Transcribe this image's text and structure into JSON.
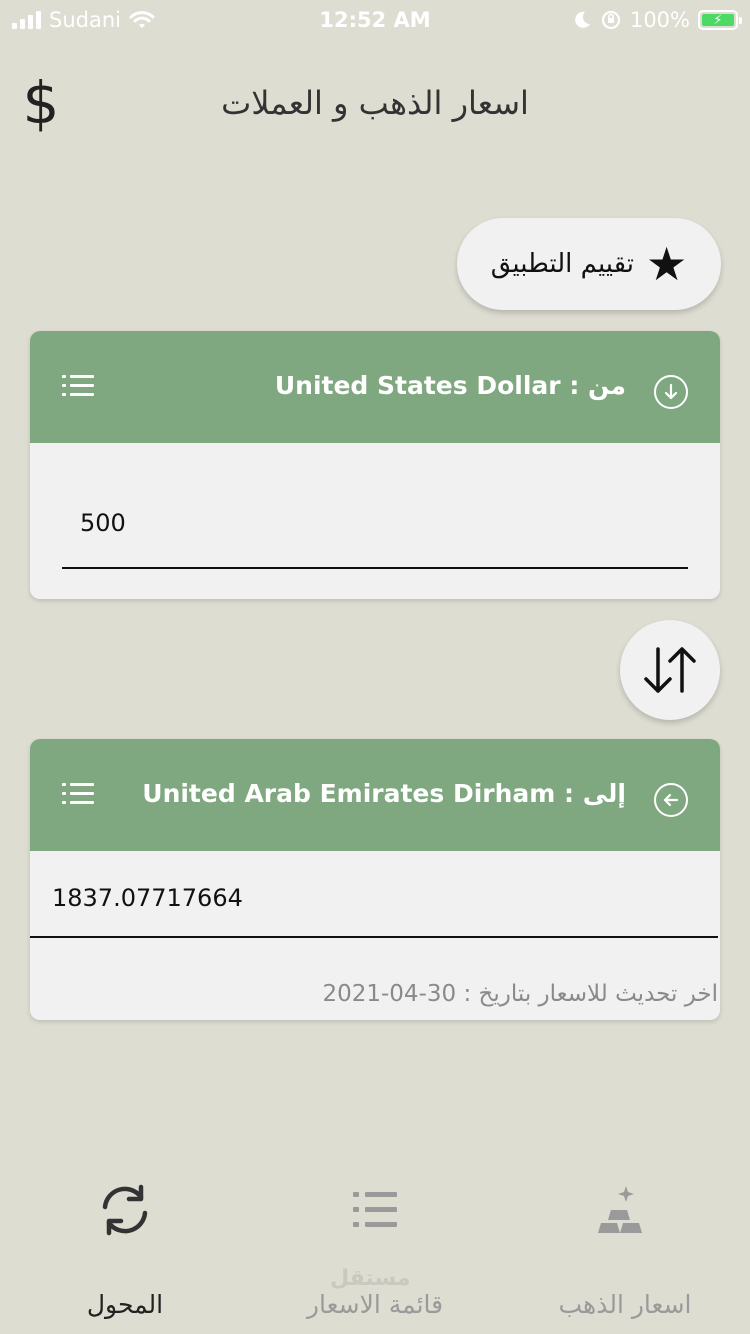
{
  "status_bar": {
    "carrier": "Sudani",
    "time": "12:52 AM",
    "battery": "100%"
  },
  "header": {
    "title": "اسعار الذهب و العملات",
    "dollar_icon": "dollar-icon"
  },
  "rate_button": {
    "label": "تقييم التطبيق",
    "icon": "star-icon"
  },
  "from_card": {
    "label": "من : United States Dollar",
    "amount": "500",
    "icon": "arrow-down-circle-icon",
    "menu_icon": "list-icon"
  },
  "to_card": {
    "label": "إلى : United Arab Emirates Dirham",
    "result": "1837.07717664",
    "update_note": "اخر تحديث للاسعار بتاريخ : 30-04-2021",
    "icon": "arrow-left-circle-icon",
    "menu_icon": "list-icon"
  },
  "bottom_nav": {
    "items": [
      {
        "label": "المحول",
        "icon": "refresh-icon",
        "active": true
      },
      {
        "label": "قائمة الاسعار",
        "icon": "list-icon",
        "active": false
      },
      {
        "label": "اسعار الذهب",
        "icon": "gold-bars-icon",
        "active": false
      }
    ]
  },
  "watermark": "مستقل",
  "colors": {
    "background": "#deddd2",
    "card_header": "#80a880",
    "card_body": "#f1f1f1",
    "battery": "#4cd964"
  }
}
